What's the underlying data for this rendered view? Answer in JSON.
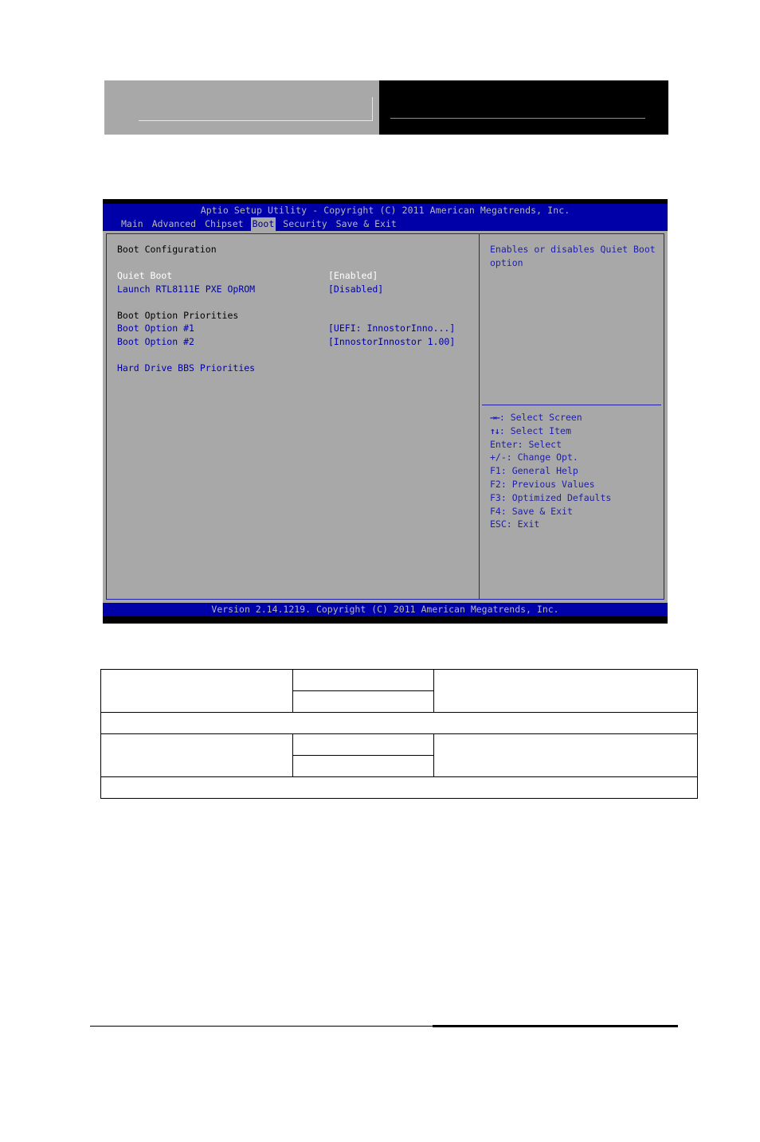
{
  "document": {
    "header": {
      "left_box_color": "#a8a8a8",
      "right_box_color": "#000000"
    },
    "bottom_rule": true
  },
  "bios": {
    "title": "Aptio Setup Utility - Copyright (C) 2011 American Megatrends, Inc.",
    "version_line": "Version 2.14.1219. Copyright (C) 2011 American Megatrends, Inc.",
    "colors": {
      "background_blue": "#0000a8",
      "panel_gray": "#a8a8a8",
      "text_gray": "#b8b8b8",
      "text_blue": "#0000a8",
      "text_selected": "#ffffff",
      "heading_black": "#000000"
    },
    "menu": {
      "items": [
        {
          "label": "Main",
          "active": false
        },
        {
          "label": "Advanced",
          "active": false
        },
        {
          "label": "Chipset",
          "active": false
        },
        {
          "label": "Boot",
          "active": true
        },
        {
          "label": "Security",
          "active": false
        },
        {
          "label": "Save & Exit",
          "active": false
        }
      ]
    },
    "left_panel": {
      "section_title": "Boot Configuration",
      "options": [
        {
          "label": "Quiet Boot",
          "value": "[Enabled]",
          "selected": true
        },
        {
          "label": "Launch RTL8111E PXE OpROM",
          "value": "[Disabled]",
          "selected": false
        }
      ],
      "priorities_title": "Boot Option Priorities",
      "priority_options": [
        {
          "label": "Boot Option #1",
          "value": "[UEFI: InnostorInno...]",
          "selected": false
        },
        {
          "label": "Boot Option #2",
          "value": "[InnostorInnostor 1.00]",
          "selected": false
        }
      ],
      "submenu": "Hard Drive BBS Priorities"
    },
    "right_panel": {
      "help_text": "Enables or disables Quiet Boot\noption",
      "keys": [
        {
          "glyph": "→←",
          "text": ": Select Screen"
        },
        {
          "glyph": "↑↓",
          "text": ": Select Item"
        },
        {
          "glyph": "Enter",
          "text": ": Select"
        },
        {
          "glyph": "+/-",
          "text": ": Change Opt."
        },
        {
          "glyph": "F1",
          "text": ": General Help"
        },
        {
          "glyph": "F2",
          "text": ": Previous Values"
        },
        {
          "glyph": "F3",
          "text": ": Optimized Defaults"
        },
        {
          "glyph": "F4",
          "text": ": Save & Exit"
        },
        {
          "glyph": "ESC",
          "text": ": Exit"
        }
      ]
    }
  },
  "spec_table": {
    "rows": [
      {
        "type": "split",
        "cells": [
          "",
          "",
          "",
          ""
        ]
      },
      {
        "type": "full",
        "cells": [
          ""
        ]
      },
      {
        "type": "split",
        "cells": [
          "",
          "",
          "",
          ""
        ]
      },
      {
        "type": "full",
        "cells": [
          ""
        ]
      }
    ]
  }
}
